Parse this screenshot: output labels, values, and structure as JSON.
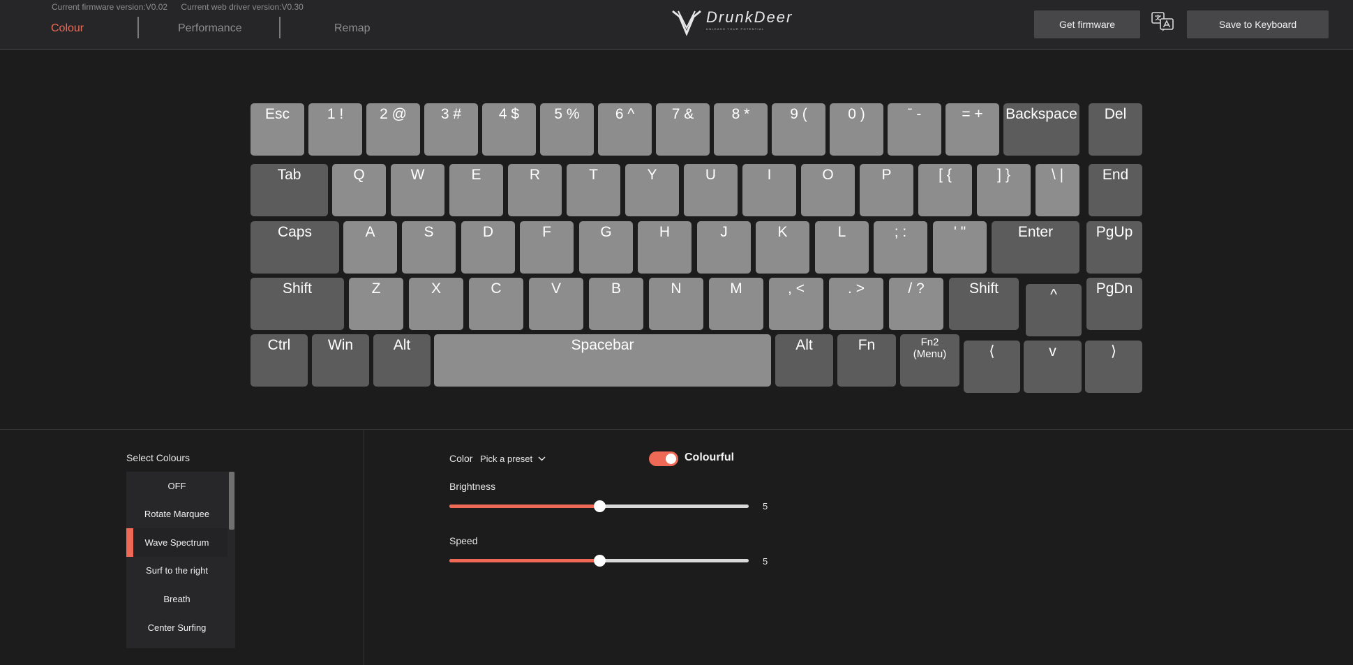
{
  "header": {
    "firmware_version": "Current firmware version:V0.02",
    "web_driver_version": "Current web driver version:V0.30",
    "tabs": [
      {
        "label": "Colour",
        "active": true
      },
      {
        "label": "Performance",
        "active": false
      },
      {
        "label": "Remap",
        "active": false
      }
    ],
    "logo": {
      "name": "DrunkDeer",
      "tagline": "Unleash your potential"
    },
    "get_firmware_label": "Get firmware",
    "save_label": "Save to Keyboard",
    "language_icon": "translate-icon"
  },
  "keyboard": {
    "rows": [
      [
        "Esc",
        "1 !",
        "2 @",
        "3 #",
        "4 $",
        "5 %",
        "6 ^",
        "7 &",
        "8 *",
        "9 (",
        "0 )",
        "ˉ -",
        "= +",
        "Backspace",
        "Del"
      ],
      [
        "Tab",
        "Q",
        "W",
        "E",
        "R",
        "T",
        "Y",
        "U",
        "I",
        "O",
        "P",
        "[ {",
        "] }",
        "\\ |",
        "End"
      ],
      [
        "Caps",
        "A",
        "S",
        "D",
        "F",
        "G",
        "H",
        "J",
        "K",
        "L",
        "; :",
        "' \"",
        "Enter",
        "PgUp"
      ],
      [
        "Shift",
        "Z",
        "X",
        "C",
        "V",
        "B",
        "N",
        "M",
        ", <",
        ". >",
        "/ ?",
        "Shift",
        "^",
        "PgDn"
      ],
      [
        "Ctrl",
        "Win",
        "Alt",
        "Spacebar",
        "Alt",
        "Fn",
        "Fn2 (Menu)",
        "⟨",
        "v",
        "⟩"
      ]
    ]
  },
  "colours": {
    "title": "Select Colours",
    "items": [
      "OFF",
      "Rotate Marquee",
      "Wave Spectrum",
      "Surf to the right",
      "Breath",
      "Center Surfing"
    ],
    "selected": "Wave Spectrum"
  },
  "controls": {
    "color_label": "Color",
    "preset_label": "Pick a preset",
    "colourful_label": "Colourful",
    "colourful_on": true,
    "brightness": {
      "label": "Brightness",
      "value": 5,
      "max": 9
    },
    "speed": {
      "label": "Speed",
      "value": 5,
      "max": 9
    }
  },
  "colors": {
    "accent": "#ee6a56",
    "background": "#1c1c1c",
    "header": "#262628",
    "key_light": "#8d8d8d",
    "key_dark": "#5c5c5c"
  }
}
